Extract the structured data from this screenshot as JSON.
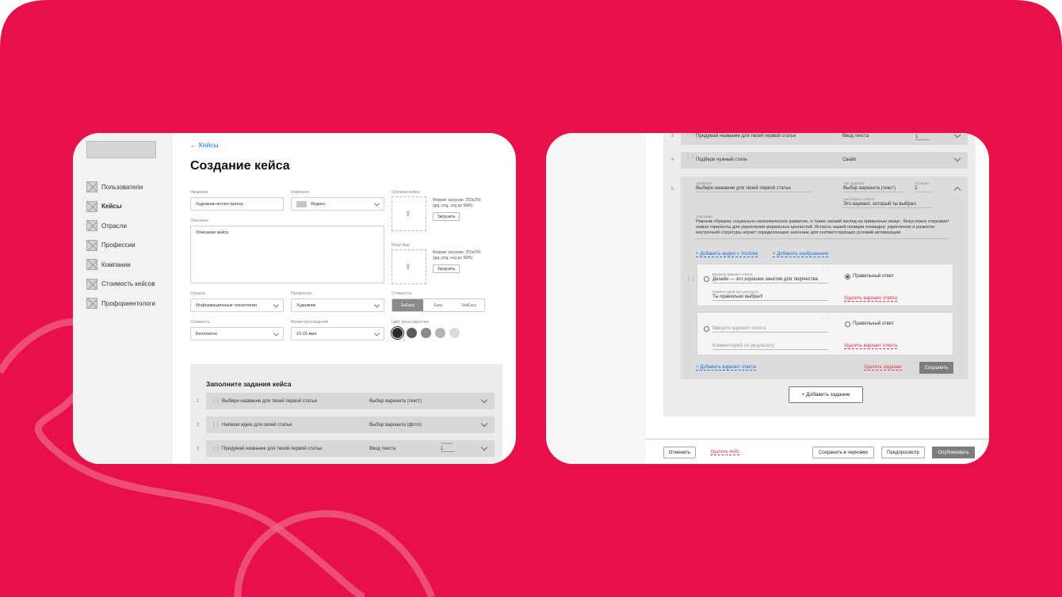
{
  "left": {
    "nav": [
      {
        "label": "Пользователи",
        "active": false
      },
      {
        "label": "Кейсы",
        "active": true
      },
      {
        "label": "Отрасли",
        "active": false
      },
      {
        "label": "Профессии",
        "active": false
      },
      {
        "label": "Компании",
        "active": false
      },
      {
        "label": "Стоимость кейсов",
        "active": false
      },
      {
        "label": "Профориентологи",
        "active": false
      }
    ],
    "back": "← Кейсы",
    "title": "Создание кейса",
    "form": {
      "name_label": "Название",
      "name_value": "Художник-иллюстратор",
      "company_label": "Компания",
      "company_value": "Яндекс",
      "cover_label": "Обложка кейса",
      "cover_format": "Формат загрузки: 250х250",
      "cover_format2": "(jpg, png, svg до 5МБ)",
      "upload": "Загрузить",
      "desc_label": "Описание",
      "desc_value": "Описание кейса",
      "roadmap_label": "Road Map",
      "industry_label": "Отрасль",
      "industry_value": "Информационные технологии",
      "profession_label": "Профессия",
      "profession_value": "Художник",
      "difficulty_label": "Сложность",
      "difficulty": [
        "SoEasy",
        "Easy",
        "NotEasy"
      ],
      "cost_label": "Стоимость",
      "cost_value": "Бесплатно",
      "time_label": "Время прохождения",
      "time_value": "10-15 мин",
      "color_label": "Цвет фона карточки",
      "colors": [
        "#2a2a2a",
        "#5a5a5a",
        "#8a8a8a",
        "#b5b5b5",
        "#dcdcdc"
      ]
    },
    "tasks_title": "Заполните задания кейса",
    "tasks": [
      {
        "num": "1",
        "name": "Выбери название для твоей первой статьи",
        "type": "Выбор варианта (текст)",
        "pos_label": "",
        "pos": ""
      },
      {
        "num": "2",
        "name": "Напиши идею для своей статьи",
        "type": "Выбор варианта (фото)",
        "pos_label": "",
        "pos": ""
      },
      {
        "num": "3",
        "name": "Придумай название для твоей первой статьи",
        "type": "Ввод текста",
        "pos_label": "Позиция",
        "pos": "1"
      }
    ]
  },
  "right": {
    "rows": [
      {
        "num": "3",
        "name": "Придумай название для твоей первой статьи",
        "type": "Ввод текста",
        "pos": "1"
      },
      {
        "num": "4",
        "name": "Подбери нужный стиль",
        "type": "Свайп",
        "pos": ""
      }
    ],
    "open": {
      "num": "5",
      "name_label": "Название",
      "name": "Выбери название для твоей первой статьи",
      "type_label": "Тип задания",
      "type": "Выбор варианта (текст)",
      "pos_label": "Позиция",
      "pos": "2",
      "q_label": "Заголовок к статье",
      "q": "Это вариант, который ты выбрал.",
      "desc_label": "Описание",
      "desc": "Равным образом, социально-экономическое развитие, а также свежий взгляд на привычные вещи - безусловно открывает новые горизонты для укрепления моральных ценностей. Ясность нашей позиции очевидна: укрепление и развитие внутренней структуры играет определяющее значение для соответствующих условий активизации.",
      "add_video": "+ Добавить видео с Youtube",
      "add_image": "+ Добавить изображение",
      "answers": [
        {
          "label": "Введите вариант ответа",
          "value": "Дизайн — это хорошее занятие для творчества",
          "c_label": "Комментарий про результат",
          "comment": "Ты правильно выбрал!",
          "correct": true
        },
        {
          "label": "",
          "value": "Введите вариант ответа",
          "c_label": "",
          "comment": "Комментарий по результату",
          "correct": false
        }
      ],
      "correct_label": "Правильный ответ",
      "delete_answer": "Удалить вариант ответа",
      "add_answer": "+ Добавить вариант ответа",
      "delete_task": "Удалить задание",
      "save": "Сохранить"
    },
    "add_task": "+ Добавить задание",
    "footer": {
      "cancel": "Отменить",
      "delete": "Удалить кейс",
      "draft": "Сохранить в черновик",
      "preview": "Предпросмотр",
      "publish": "Опубликовать"
    }
  }
}
